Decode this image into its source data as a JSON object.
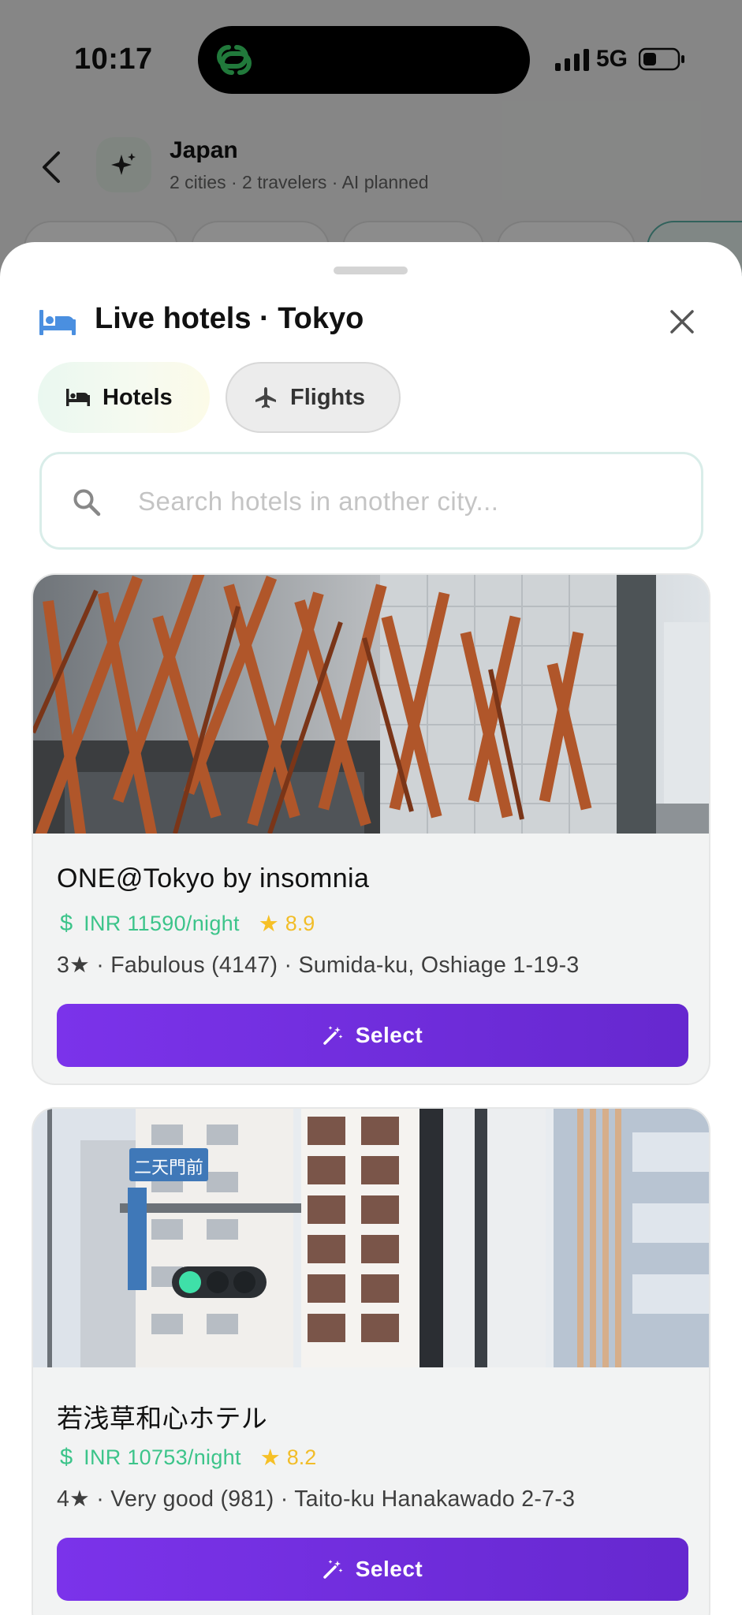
{
  "status_bar": {
    "time": "10:17",
    "network": "5G"
  },
  "trip": {
    "title": "Japan",
    "subtitle": "2 cities · 2 travelers · AI planned"
  },
  "sheet": {
    "title": "Live hotels · Tokyo",
    "tabs": [
      {
        "label": "Hotels",
        "active": true
      },
      {
        "label": "Flights",
        "active": false
      }
    ],
    "search": {
      "placeholder": "Search hotels in another city..."
    }
  },
  "hotels": [
    {
      "name": "ONE@Tokyo by insomnia",
      "price": "INR 11590/night",
      "rating": "8.9",
      "meta": "3★ · Fabulous (4147) · Sumida-ku, Oshiage 1-19-3",
      "button": "Select"
    },
    {
      "name": "若浅草和心ホテル",
      "price": "INR 10753/night",
      "rating": "8.2",
      "meta": "4★ · Very good (981) · Taito-ku Hanakawado 2-7-3",
      "button": "Select",
      "sign_text": "二天門前"
    }
  ],
  "colors": {
    "accent": "#6b2bd9",
    "price": "#3cc48a",
    "rating": "#f2bd28",
    "brand_icon": "#4a8fe0"
  }
}
